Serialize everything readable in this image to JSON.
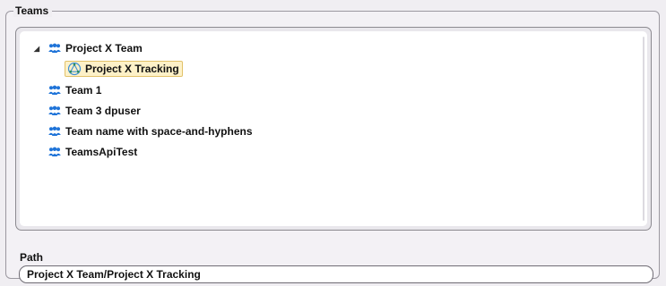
{
  "group": {
    "title": "Teams"
  },
  "tree": {
    "items": [
      {
        "label": "Project X Team",
        "icon": "team-icon",
        "expanded": true
      },
      {
        "label": "Project X Tracking",
        "icon": "tracking-icon",
        "selected": true
      },
      {
        "label": "Team 1",
        "icon": "team-icon"
      },
      {
        "label": "Team 3 dpuser",
        "icon": "team-icon"
      },
      {
        "label": "Team name with space-and-hyphens",
        "icon": "team-icon"
      },
      {
        "label": "TeamsApiTest",
        "icon": "team-icon"
      }
    ]
  },
  "path": {
    "label": "Path",
    "value": "Project X Team/Project X Tracking"
  },
  "colors": {
    "team_icon": "#1e73d8",
    "selection_bg": "#fdf1c8",
    "selection_border": "#e2c26a"
  }
}
